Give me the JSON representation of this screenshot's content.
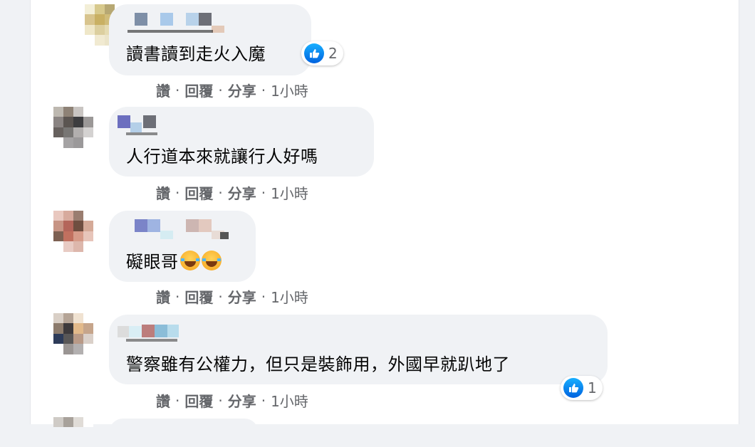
{
  "comments": [
    {
      "text": "讀書讀到走火入魔",
      "likes": "2",
      "actions": {
        "like": "讚",
        "reply": "回覆",
        "share": "分享",
        "time": "1小時"
      }
    },
    {
      "text": "人行道本來就讓行人好嗎",
      "actions": {
        "like": "讚",
        "reply": "回覆",
        "share": "分享",
        "time": "1小時"
      }
    },
    {
      "text": "礙眼哥",
      "emoji": "face-with-tears-of-joy-icon x2",
      "actions": {
        "like": "讚",
        "reply": "回覆",
        "share": "分享",
        "time": "1小時"
      }
    },
    {
      "text": "警察雖有公權力，但只是裝飾用，外國早就趴地了",
      "likes": "1",
      "actions": {
        "like": "讚",
        "reply": "回覆",
        "share": "分享",
        "time": "1小時"
      }
    }
  ],
  "separator": "·",
  "colors": {
    "page_bg": "#f0f2f5",
    "bubble": "#f0f2f5",
    "meta_text": "#65676b",
    "like_blue": "#1877f2"
  }
}
